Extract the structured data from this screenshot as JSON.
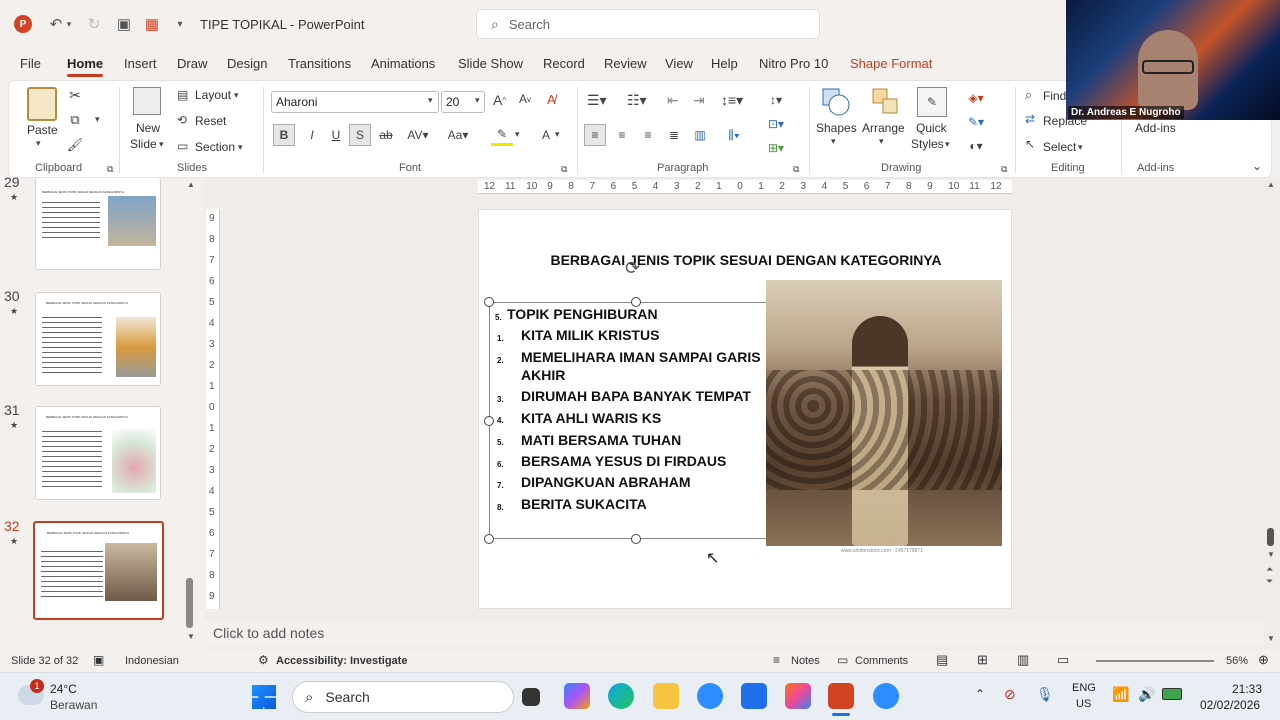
{
  "window": {
    "title": "TIPE  TOPIKAL  -  PowerPoint",
    "search_placeholder": "Search"
  },
  "tabs": [
    "File",
    "Home",
    "Insert",
    "Draw",
    "Design",
    "Transitions",
    "Animations",
    "Slide Show",
    "Record",
    "Review",
    "View",
    "Help",
    "Nitro Pro 10",
    "Shape Format"
  ],
  "ribbon": {
    "clipboard": {
      "label": "Clipboard",
      "paste": "Paste"
    },
    "slides": {
      "label": "Slides",
      "new_slide": "New",
      "new_slide2": "Slide",
      "layout": "Layout",
      "reset": "Reset",
      "section": "Section"
    },
    "font": {
      "label": "Font",
      "font_name": "Aharoni",
      "font_size": "20"
    },
    "paragraph": {
      "label": "Paragraph"
    },
    "drawing": {
      "label": "Drawing",
      "shapes": "Shapes",
      "arrange": "Arrange",
      "quick_styles": "Quick",
      "quick_styles2": "Styles"
    },
    "editing": {
      "label": "Editing",
      "find": "Find",
      "replace": "Replace",
      "select": "Select"
    },
    "addins": {
      "label": "Add-ins",
      "button": "Add-ins"
    }
  },
  "webcam": {
    "name": "Dr. Andreas E Nugroho"
  },
  "thumbnails": [
    {
      "num": "29"
    },
    {
      "num": "30"
    },
    {
      "num": "31"
    },
    {
      "num": "32"
    }
  ],
  "thumb_title": "BERBAGAI JENIS TOPIK SESUAI DENGAN KATEGORINYA",
  "slide": {
    "title": "BERBAGAI JENIS TOPIK SESUAI DENGAN KATEGORINYA",
    "heading_num": "5.",
    "heading": "TOPIK PENGHIBURAN",
    "items": [
      {
        "num": "1.",
        "text": "KITA MILIK KRISTUS"
      },
      {
        "num": "2.",
        "text": "MEMELIHARA IMAN SAMPAI GARIS"
      },
      {
        "num": "",
        "text": "AKHIR"
      },
      {
        "num": "3.",
        "text": "DIRUMAH BAPA BANYAK TEMPAT"
      },
      {
        "num": "4.",
        "text": "KITA AHLI WARIS KS"
      },
      {
        "num": "5.",
        "text": "MATI BERSAMA TUHAN"
      },
      {
        "num": "6.",
        "text": "BERSAMA YESUS DI FIRDAUS"
      },
      {
        "num": "7.",
        "text": "DIPANGKUAN ABRAHAM"
      },
      {
        "num": "8.",
        "text": "BERITA SUKACITA"
      }
    ],
    "image_caption": "www.shutterstock.com · 2457178871"
  },
  "ruler": [
    "12",
    "11",
    "10",
    "9",
    "8",
    "7",
    "6",
    "5",
    "4",
    "3",
    "2",
    "1",
    "0",
    "1",
    "2",
    "3",
    "4",
    "5",
    "6",
    "7",
    "8",
    "9",
    "10",
    "11",
    "12"
  ],
  "vruler": [
    "9",
    "8",
    "7",
    "6",
    "5",
    "4",
    "3",
    "2",
    "1",
    "0",
    "1",
    "2",
    "3",
    "4",
    "5",
    "6",
    "7",
    "8",
    "9"
  ],
  "notes_placeholder": "Click to add notes",
  "status": {
    "slide": "Slide 32 of 32",
    "language": "Indonesian",
    "accessibility": "Accessibility: Investigate",
    "notes": "Notes",
    "comments": "Comments",
    "zoom": "56%"
  },
  "taskbar": {
    "temp": "24°C",
    "weather": "Berawan",
    "search": "Search",
    "lang1": "ENG",
    "lang2": "US",
    "time": "21:33",
    "date": "02/02/2026",
    "badge": "1"
  },
  "colors": {
    "accent": "#c43e1c",
    "shape_format": "#c43e1c"
  }
}
